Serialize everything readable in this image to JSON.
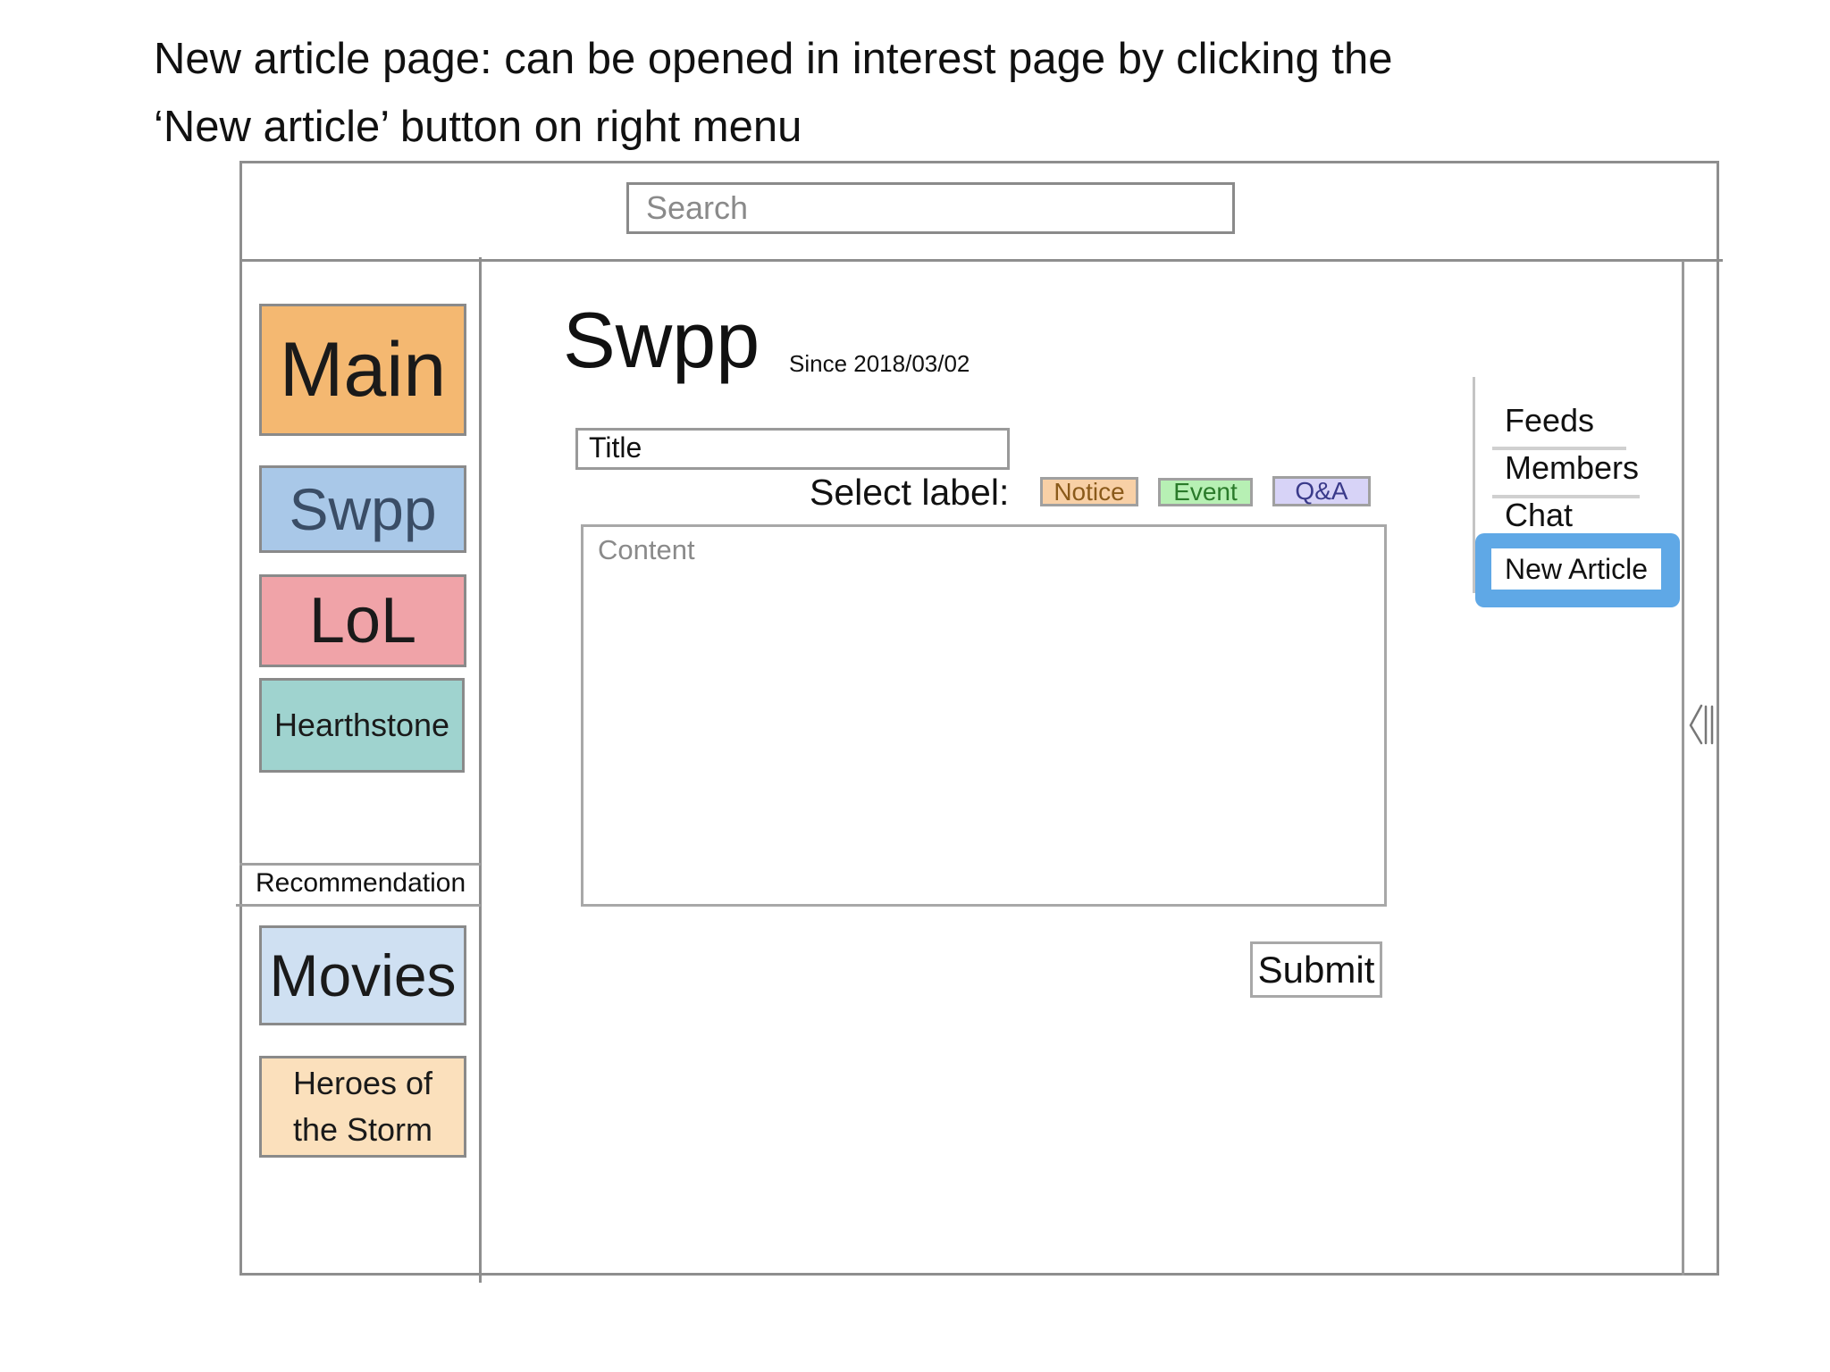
{
  "caption": {
    "line1": "New article page: can be opened in interest page by clicking the",
    "line2": "‘New article’ button on right menu"
  },
  "search": {
    "placeholder": "Search"
  },
  "sidebar": {
    "items": [
      {
        "label": "Main",
        "color": "#f4b871"
      },
      {
        "label": "Swpp",
        "color": "#a9c8e8"
      },
      {
        "label": "LoL",
        "color": "#f0a3a8"
      },
      {
        "label": "Hearthstone",
        "color": "#9fd3cf"
      }
    ],
    "recommendation_label": "Recommendation",
    "recommendations": [
      {
        "label": "Movies",
        "color": "#cfe0f2"
      },
      {
        "label_line1": "Heroes of",
        "label_line2": "the Storm",
        "color": "#fbe0bc"
      }
    ]
  },
  "main": {
    "title": "Swpp",
    "since": "Since 2018/03/02",
    "form": {
      "title_placeholder": "Title",
      "select_label": "Select label:",
      "labels": [
        {
          "text": "Notice",
          "color": "#f8d0a6"
        },
        {
          "text": "Event",
          "color": "#b7f0b4"
        },
        {
          "text": "Q&A",
          "color": "#d7d3f7"
        }
      ],
      "content_placeholder": "Content",
      "submit_label": "Submit"
    }
  },
  "right_menu": {
    "items": [
      "Feeds",
      "Members",
      "Chat"
    ],
    "new_article_label": "New Article",
    "highlight_color": "#5fa8e6"
  },
  "icons": {
    "collapse": "collapse-panel-icon"
  }
}
